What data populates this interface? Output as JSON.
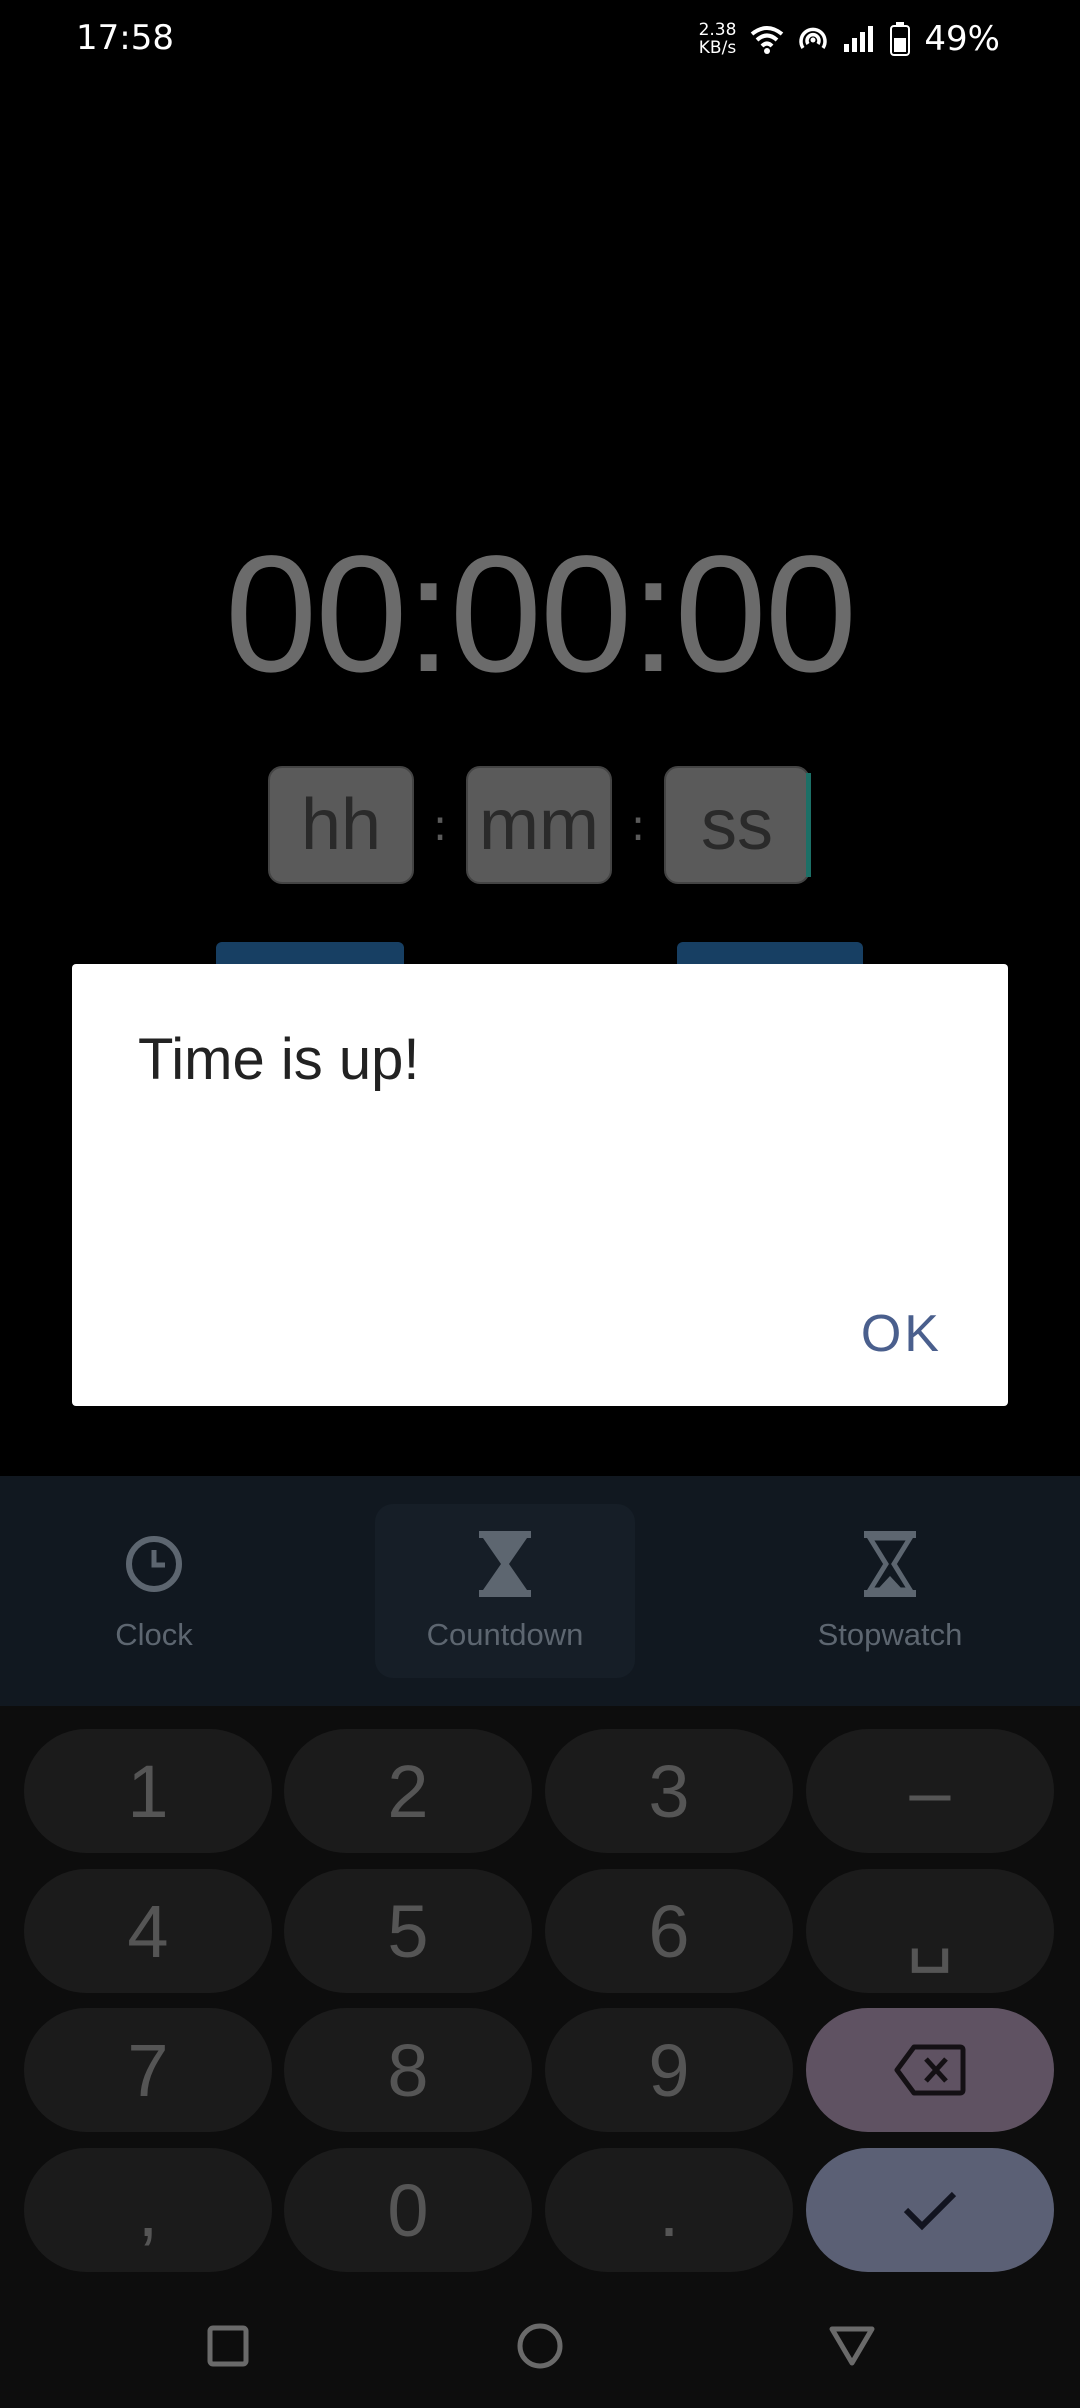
{
  "status_bar": {
    "time": "17:58",
    "speed_value": "2.38",
    "speed_unit": "KB/s",
    "battery": "49%"
  },
  "timer": {
    "display": "00:00:00",
    "hours_placeholder": "hh",
    "minutes_placeholder": "mm",
    "seconds_placeholder": "ss",
    "separator": ":"
  },
  "dialog": {
    "title": "Time is up!",
    "ok_label": "OK"
  },
  "bottom_nav": {
    "items": [
      {
        "label": "Clock",
        "icon": "clock-icon"
      },
      {
        "label": "Countdown",
        "icon": "hourglass-icon"
      },
      {
        "label": "Stopwatch",
        "icon": "hourglass-icon"
      }
    ],
    "active": "Countdown"
  },
  "keypad": {
    "keys": [
      "1",
      "2",
      "3",
      "–",
      "4",
      "5",
      "6",
      "␣",
      "7",
      "8",
      "9",
      "backspace",
      ",",
      "0",
      ".",
      "confirm"
    ]
  },
  "colors": {
    "dialog_accent": "#4a5f8d",
    "backspace_key": "#5f5262",
    "confirm_key": "#5b6075"
  }
}
